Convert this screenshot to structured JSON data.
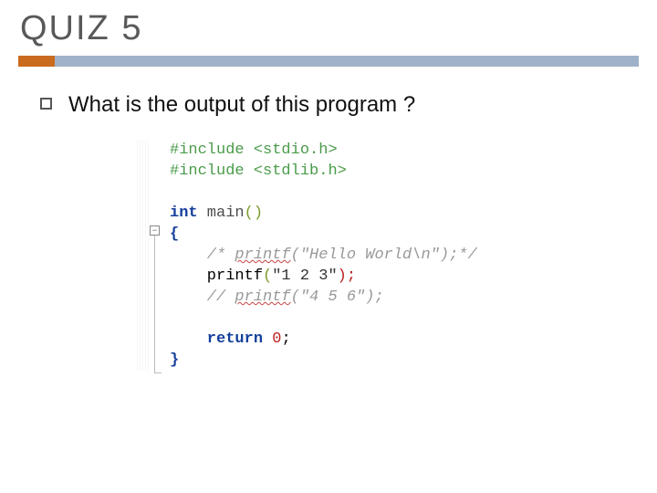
{
  "title": "QUIZ 5",
  "bullet": "What is the output of this program ?",
  "code": {
    "line1_include1": "#include",
    "line1_header1": " <stdio.h>",
    "line2_include2": "#include",
    "line2_header2": " <stdlib.h>",
    "line4_int": "int",
    "line4_main": " main",
    "line4_parens": "()",
    "line5_brace_open": "{",
    "line6_cm_open": "    /* ",
    "line6_printf": "printf",
    "line6_cm_rest": "(\"Hello World\\n\");*/",
    "line7_printf": "    printf",
    "line7_paren_open": "(",
    "line7_str": "\"1 2 3\"",
    "line7_close": ");",
    "line8_cm_open": "    // ",
    "line8_printf": "printf",
    "line8_cm_rest": "(\"4 5 6\");",
    "line10_return": "    return",
    "line10_space": " ",
    "line10_zero": "0",
    "line10_semi": ";",
    "line11_brace_close": "}"
  }
}
